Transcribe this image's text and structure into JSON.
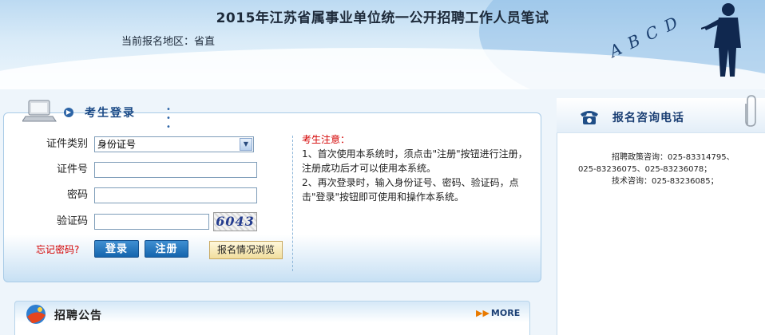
{
  "header": {
    "title": "2015年江苏省属事业单位统一公开招聘工作人员笔试",
    "region_label": "当前报名地区：",
    "region_value": "省直",
    "decor_text": "A B C D"
  },
  "login": {
    "title": "考生登录",
    "id_type_label": "证件类别",
    "id_type_value": "身份证号",
    "id_number_label": "证件号",
    "id_number_value": "",
    "password_label": "密码",
    "password_value": "",
    "captcha_label": "验证码",
    "captcha_value": "",
    "captcha_image_text": "6043",
    "forgot_password": "忘记密码?",
    "login_button": "登录",
    "register_button": "注册",
    "browse_button": "报名情况浏览"
  },
  "notice": {
    "title": "考生注意：",
    "item1": "1、首次使用本系统时，须点击\"注册\"按钮进行注册，注册成功后才可以使用本系统。",
    "item2": "2、再次登录时，输入身份证号、密码、验证码，点击\"登录\"按钮即可使用和操作本系统。"
  },
  "announcement": {
    "title": "招聘公告",
    "more": "MORE"
  },
  "contact": {
    "title": "报名咨询电话",
    "line1": "招聘政策咨询：025-83314795、",
    "line2": "025-83236075、025-83236078；",
    "line3": "技术咨询：025-83236085；"
  },
  "colors": {
    "accent": "#1b4a86",
    "notice_red": "#d40000",
    "button_blue": "#1565ad"
  }
}
